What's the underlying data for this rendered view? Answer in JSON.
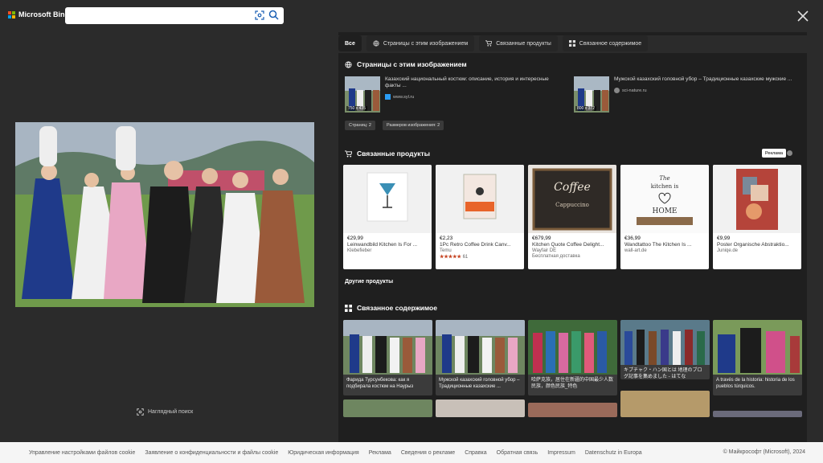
{
  "header": {
    "brand": "Microsoft Bing",
    "search_value": "",
    "brand_colors": [
      "#f25022",
      "#7fba00",
      "#00a4ef",
      "#ffb900"
    ]
  },
  "left": {
    "visual_search_label": "Наглядный поиск"
  },
  "tabs": [
    {
      "label": "Все",
      "icon": ""
    },
    {
      "label": "Страницы с этим изображением",
      "icon": "globe-icon"
    },
    {
      "label": "Связанные продукты",
      "icon": "cart-icon"
    },
    {
      "label": "Связанное содержимое",
      "icon": "grid-icon"
    }
  ],
  "pages": {
    "title": "Страницы с этим изображением",
    "items": [
      {
        "text": "Казахский национальный костюм: описание, история и интересные факты ...",
        "site": "www.syl.ru",
        "dims": "750 x 435"
      },
      {
        "text": "Мужской казахский головной убор – Традиционные казахские мужские ...",
        "site": "sci-nature.ru",
        "dims": "800 x 372"
      }
    ],
    "chips": [
      "Страниц: 2",
      "Размеров изображения: 2"
    ]
  },
  "products": {
    "title": "Связанные продукты",
    "ad_label": "Реклама",
    "items": [
      {
        "price": "€29,99",
        "name": "Leinwandbild Kitchen Is For ...",
        "store": "Klebefieber",
        "rating": "",
        "rating_count": ""
      },
      {
        "price": "€2,23",
        "name": "1Pc Retro Coffee Drink Canv...",
        "store": "Temu",
        "rating": "★★★★★",
        "rating_count": "61"
      },
      {
        "price": "€679,99",
        "name": "Kitchen Quote Coffee Delight...",
        "store": "Wayfair DE",
        "extra": "Бесплатная доставка",
        "rating": "",
        "rating_count": ""
      },
      {
        "price": "€36,99",
        "name": "Wandtattoo The Kitchen Is ...",
        "store": "wall-art.de",
        "rating": "",
        "rating_count": ""
      },
      {
        "price": "€9,99",
        "name": "Poster Organische Abstraktio...",
        "store": "Juniqe.de",
        "rating": "",
        "rating_count": ""
      }
    ],
    "more_label": "Другие продукты"
  },
  "related": {
    "title": "Связанное содержимое",
    "items": [
      {
        "text": "Фарида Турсунбекова: как я подбирала костюм на Наурыз"
      },
      {
        "text": "Мужской казахский головной убор – Традиционные казахские ..."
      },
      {
        "text": "哈萨克族，居住在新疆的中国最少人数民族，颜色民族_特色"
      },
      {
        "text": "キプチャク・ハン国とは 地理のブログ記事を集めました - はてな"
      },
      {
        "text": "A través de la historia: historia de los pueblos túrquicos."
      }
    ]
  },
  "footer": {
    "links": [
      "Управление настройками файлов cookie",
      "Заявление о конфиденциальности и файлы cookie",
      "Юридическая информация",
      "Реклама",
      "Сведения о рекламе",
      "Справка",
      "Обратная связь",
      "Impressum",
      "Datenschutz in Europa"
    ],
    "copyright": "© Майкрософт (Microsoft), 2024"
  }
}
